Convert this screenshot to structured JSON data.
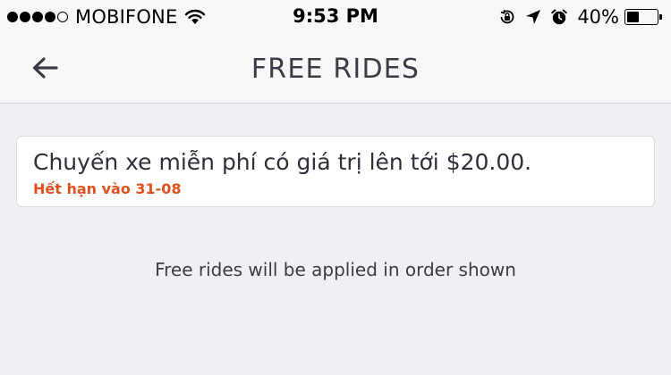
{
  "status_bar": {
    "carrier": "MOBIFONE",
    "signal_bars_filled": 4,
    "signal_bars_total": 5,
    "time": "9:53 PM",
    "battery_percent": "40%",
    "icons": [
      "wifi-icon",
      "orientation-lock-icon",
      "location-arrow-icon",
      "alarm-icon",
      "battery-icon"
    ]
  },
  "nav": {
    "title": "FREE RIDES",
    "back_icon": "back-arrow-icon"
  },
  "free_rides": [
    {
      "title": "Chuyến xe miễn phí có giá trị lên tới $20.00.",
      "expiry": "Hết hạn vào 31-08"
    }
  ],
  "footer_note": "Free rides will be applied in order shown",
  "colors": {
    "background": "#efeff4",
    "bar_background": "#f7f7f7",
    "card_background": "#ffffff",
    "expiry_accent": "#e0511f",
    "text_primary": "#2f2f3a"
  }
}
